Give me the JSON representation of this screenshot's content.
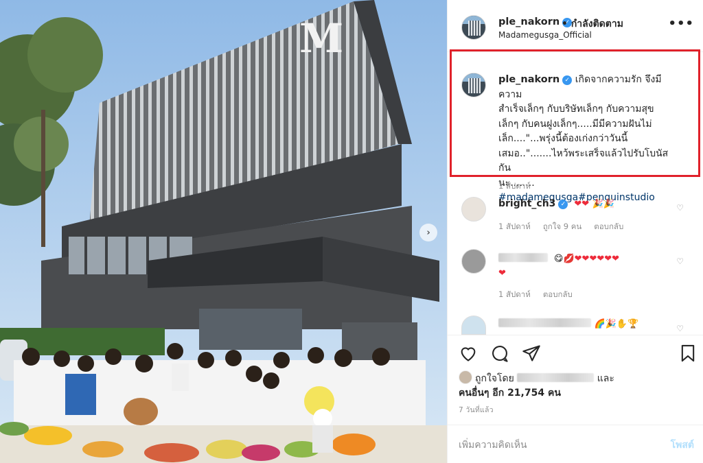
{
  "post": {
    "username": "ple_nakorn",
    "follow_status": "• กำลังติดตาม",
    "location": "Madamegusga_Official",
    "more": "•••",
    "caption_lines": [
      "เกิดจากความรัก จึงมีความ",
      "สำเร็จเล็กๆ กับบริษัทเล็กๆ กับความสุข",
      "เล็กๆ กับคนฝูงเล็กๆ.....มีมีความฝันไม่",
      "เล็ก....\"...พรุ่งนี้ต้องเก่งกว่าวันนี้",
      "เสมอ..\".......ไหว้พระเสร็จแล้วไปรับโบนัสกัน",
      "นะ........"
    ],
    "hashtags": "#madamegusga#penguinstudio",
    "caption_time": "1 สัปดาห์"
  },
  "comments": [
    {
      "user": "bright_ch3",
      "time": "1 สัปดาห์",
      "likes": "ถูกใจ 9 คน",
      "reply": "ตอบกลับ"
    },
    {
      "user": "",
      "time": "1 สัปดาห์",
      "reply": "ตอบกลับ"
    },
    {
      "user": ""
    }
  ],
  "likes": {
    "prefix": "ถูกใจโดย",
    "and": "และ",
    "others": "คนอื่นๆ อีก 21,754 คน"
  },
  "posted": "7 วันที่แล้ว",
  "add_comment": {
    "placeholder": "เพิ่มความคิดเห็น",
    "post_label": "โพสต์"
  },
  "photo": {
    "building_logo": "M"
  },
  "icons": [
    "heart-icon",
    "comment-icon",
    "share-icon",
    "bookmark-icon",
    "chevron-right-icon",
    "verified-icon"
  ],
  "colors": {
    "accent": "#3897f0",
    "highlight_box": "#e0212a",
    "hashtag": "#003569",
    "muted": "#8e8e8e"
  }
}
